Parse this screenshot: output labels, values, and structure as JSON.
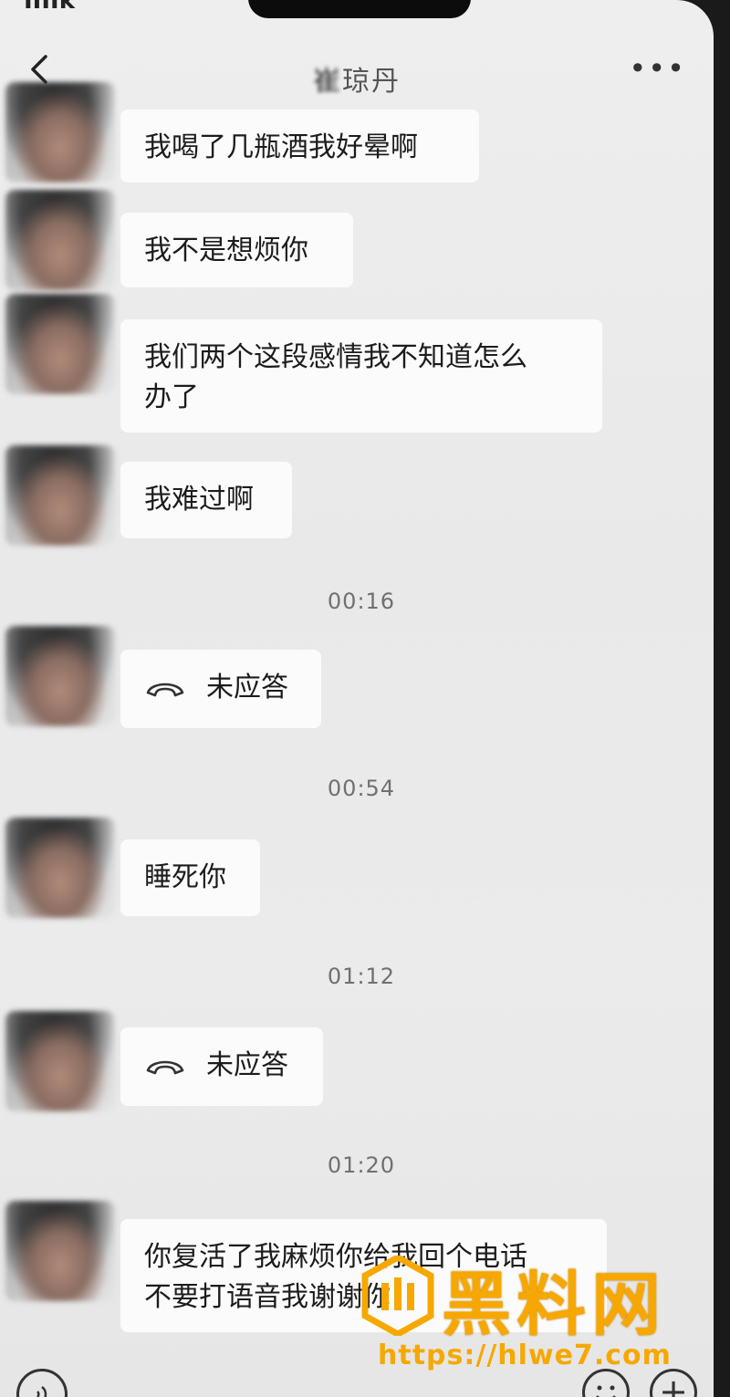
{
  "status": {
    "partial_text": "IIIIk"
  },
  "header": {
    "back_icon": "chevron-left-icon",
    "title_obscured": "崔",
    "title_visible": "琼丹",
    "more_label": "•••"
  },
  "messages": [
    {
      "type": "text",
      "text": "我喝了几瓶酒我好晕啊"
    },
    {
      "type": "text",
      "text": "我不是想烦你"
    },
    {
      "type": "text",
      "line1": "我们两个这段感情我不知道怎么",
      "line2": "办了"
    },
    {
      "type": "text",
      "text": "我难过啊"
    },
    {
      "type": "time",
      "text": "00:16"
    },
    {
      "type": "call",
      "icon": "phone-hangup-icon",
      "text": "未应答"
    },
    {
      "type": "time",
      "text": "00:54"
    },
    {
      "type": "text",
      "text": "睡死你"
    },
    {
      "type": "time",
      "text": "01:12"
    },
    {
      "type": "call",
      "icon": "phone-hangup-icon",
      "text": "未应答"
    },
    {
      "type": "time",
      "text": "01:20"
    },
    {
      "type": "text",
      "line1": "你复活了我麻烦你给我回个电话",
      "line2": "不要打语音我谢谢你"
    }
  ],
  "bottom_bar": {
    "voice_icon": "voice-icon",
    "emoji_icon": "emoji-icon",
    "plus_label": "+"
  },
  "watermark": {
    "text": "黑料网",
    "url": "https://hlwe7.com",
    "color": "#f6a800"
  }
}
